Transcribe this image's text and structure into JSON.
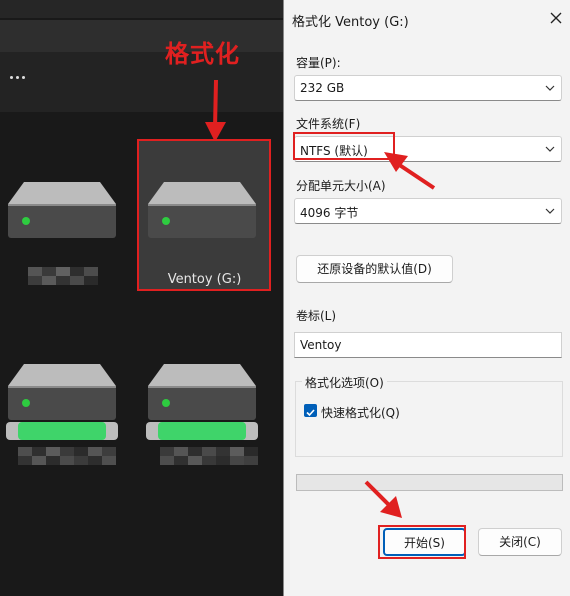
{
  "annotation": {
    "label": "格式化"
  },
  "explorer": {
    "more_glyph": "···",
    "selected_drive_label": "Ventoy (G:)"
  },
  "dialog": {
    "title": "格式化 Ventoy (G:)",
    "capacity": {
      "label": "容量(P):",
      "value": "232 GB"
    },
    "filesystem": {
      "label": "文件系统(F)",
      "value": "NTFS (默认)"
    },
    "allocation": {
      "label": "分配单元大小(A)",
      "value": "4096 字节"
    },
    "restore_defaults_label": "还原设备的默认值(D)",
    "volume": {
      "label": "卷标(L)",
      "value": "Ventoy"
    },
    "format_options": {
      "group_label": "格式化选项(O)",
      "quick_format_label": "快速格式化(Q)",
      "quick_format_checked": true
    },
    "progress": 0,
    "start_label": "开始(S)",
    "close_label": "关闭(C)"
  },
  "colors": {
    "annotation": "#e02020",
    "accent": "#005fb8",
    "drive_led": "#2ecc40",
    "drive_band": "#3fd46a"
  }
}
